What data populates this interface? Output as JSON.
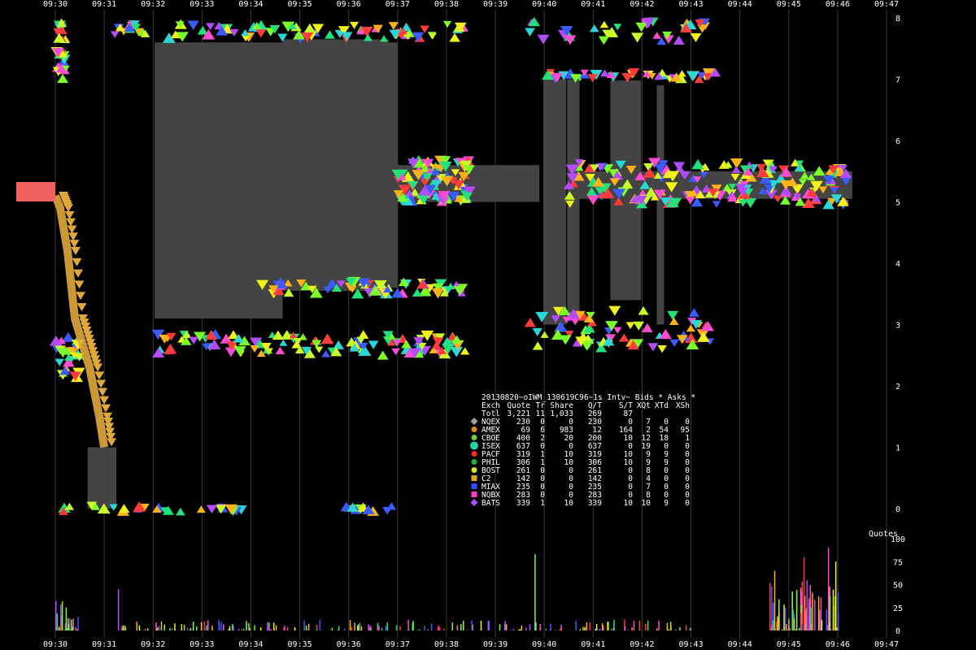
{
  "chart_data": [
    {
      "type": "scatter",
      "title": "20130820~oIWM_130619C96~1s Intv~ Bids * Asks *",
      "x_ticks": [
        "09:30",
        "09:31",
        "09:32",
        "09:33",
        "09:34",
        "09:35",
        "09:36",
        "09:37",
        "09:38",
        "09:39",
        "09:40",
        "09:41",
        "09:42",
        "09:43",
        "09:44",
        "09:45",
        "09:46",
        "09:47"
      ],
      "y_ticks": [
        0,
        1,
        2,
        3,
        4,
        5,
        6,
        7,
        8
      ],
      "ylim": [
        0,
        8
      ],
      "grid": true,
      "colors": {
        "background": "#000000",
        "grid": "#3a3a3a",
        "spread_fill": "#444444",
        "nbbo_walk": "#e0a83a",
        "marker_palette": [
          "#ff3b3b",
          "#ffb21a",
          "#f2f21a",
          "#7bff2a",
          "#22e07a",
          "#2ad6d6",
          "#3a5bff",
          "#b44bff",
          "#ff4bd2",
          "#c8ff2a"
        ]
      },
      "spread_blocks_minutes": [
        {
          "x0": 2.03,
          "x1": 4.65,
          "y0": 3.1,
          "y1": 7.6
        },
        {
          "x0": 4.65,
          "x1": 6.82,
          "y0": 3.55,
          "y1": 7.65
        },
        {
          "x0": 6.82,
          "x1": 7.0,
          "y0": 3.6,
          "y1": 7.6
        },
        {
          "x0": 9.98,
          "x1": 10.45,
          "y0": 3.0,
          "y1": 7.0
        },
        {
          "x0": 10.47,
          "x1": 10.72,
          "y0": 3.1,
          "y1": 7.0
        },
        {
          "x0": 11.35,
          "x1": 11.98,
          "y0": 3.4,
          "y1": 6.98
        },
        {
          "x0": 12.3,
          "x1": 12.45,
          "y0": 3.0,
          "y1": 6.9
        },
        {
          "x0": 0.66,
          "x1": 1.25,
          "y0": 0.0,
          "y1": 1.0
        }
      ],
      "bid_ask_bands_minutes": [
        {
          "x0": 7.0,
          "x1": 9.9,
          "y0": 5.0,
          "y1": 5.6
        },
        {
          "x0": 10.7,
          "x1": 16.3,
          "y0": 5.05,
          "y1": 5.5
        }
      ],
      "nbbo_walk": [
        [
          0.0,
          5.1
        ],
        [
          0.1,
          4.9
        ],
        [
          0.25,
          4.2
        ],
        [
          0.4,
          3.1
        ],
        [
          0.55,
          2.7
        ],
        [
          0.7,
          2.3
        ],
        [
          0.9,
          1.5
        ],
        [
          1.0,
          1.0
        ]
      ],
      "marker_bands": [
        {
          "x0": 0.0,
          "x1": 0.25,
          "y0": 7.0,
          "y1": 7.95,
          "n": 24
        },
        {
          "x0": 1.15,
          "x1": 1.85,
          "y0": 7.7,
          "y1": 7.9,
          "n": 14
        },
        {
          "x0": 2.3,
          "x1": 8.4,
          "y0": 7.65,
          "y1": 7.9,
          "n": 70
        },
        {
          "x0": 9.7,
          "x1": 13.3,
          "y0": 7.6,
          "y1": 7.95,
          "n": 34
        },
        {
          "x0": 10.0,
          "x1": 13.6,
          "y0": 7.0,
          "y1": 7.12,
          "n": 40
        },
        {
          "x0": 7.0,
          "x1": 8.5,
          "y0": 5.0,
          "y1": 5.7,
          "n": 90
        },
        {
          "x0": 10.5,
          "x1": 16.2,
          "y0": 4.95,
          "y1": 5.65,
          "n": 180
        },
        {
          "x0": 4.2,
          "x1": 8.4,
          "y0": 3.5,
          "y1": 3.7,
          "n": 60
        },
        {
          "x0": 2.0,
          "x1": 8.4,
          "y0": 2.5,
          "y1": 2.85,
          "n": 110
        },
        {
          "x0": 9.7,
          "x1": 13.4,
          "y0": 2.6,
          "y1": 3.25,
          "n": 70
        },
        {
          "x0": 0.0,
          "x1": 0.5,
          "y0": 2.1,
          "y1": 2.8,
          "n": 30
        },
        {
          "x0": 0.0,
          "x1": 3.9,
          "y0": -0.05,
          "y1": 0.05,
          "n": 26
        },
        {
          "x0": 5.9,
          "x1": 6.9,
          "y0": -0.05,
          "y1": 0.05,
          "n": 12
        }
      ],
      "legend_table": {
        "title": "20130820~oIWM_130619C96~1s Intv~ Bids * Asks *",
        "columns": [
          "Exch",
          "Quote",
          "Tr",
          "Share",
          "Q/T",
          "S/T",
          "XQt",
          "XTd",
          "XSh"
        ],
        "rows": [
          {
            "exch": "Totl",
            "vals": [
              "3,221",
              "11",
              "1,033",
              "269",
              "87",
              "",
              "",
              ""
            ],
            "color": "",
            "shape": ""
          },
          {
            "exch": "NQEX",
            "vals": [
              "230",
              "0",
              "0",
              "230",
              "0",
              "7",
              "0",
              "0"
            ],
            "color": "#a0a0a0",
            "shape": "diamond"
          },
          {
            "exch": "AMEX",
            "vals": [
              "69",
              "6",
              "983",
              "12",
              "164",
              "2",
              "54",
              "95"
            ],
            "color": "#e08a2a",
            "shape": "circle"
          },
          {
            "exch": "CBOE",
            "vals": [
              "400",
              "2",
              "20",
              "200",
              "10",
              "12",
              "18",
              "1"
            ],
            "color": "#7ac84a",
            "shape": "star"
          },
          {
            "exch": "ISEX",
            "vals": [
              "637",
              "0",
              "0",
              "637",
              "0",
              "19",
              "0",
              "0"
            ],
            "color": "#22d6a8",
            "shape": "bigcircle"
          },
          {
            "exch": "PACF",
            "vals": [
              "319",
              "1",
              "10",
              "319",
              "10",
              "9",
              "9",
              "0"
            ],
            "color": "#ff2a2a",
            "shape": "circle"
          },
          {
            "exch": "PHIL",
            "vals": [
              "306",
              "1",
              "10",
              "306",
              "10",
              "9",
              "9",
              "0"
            ],
            "color": "#22b04a",
            "shape": "circle"
          },
          {
            "exch": "BOST",
            "vals": [
              "261",
              "0",
              "0",
              "261",
              "0",
              "8",
              "0",
              "0"
            ],
            "color": "#c8f02a",
            "shape": "circle"
          },
          {
            "exch": "C2",
            "vals": [
              "142",
              "0",
              "0",
              "142",
              "0",
              "4",
              "0",
              "0"
            ],
            "color": "#e0a020",
            "shape": "square"
          },
          {
            "exch": "MIAX",
            "vals": [
              "235",
              "0",
              "0",
              "235",
              "0",
              "7",
              "0",
              "0"
            ],
            "color": "#3a4bff",
            "shape": "square"
          },
          {
            "exch": "NQBX",
            "vals": [
              "283",
              "0",
              "0",
              "283",
              "0",
              "8",
              "0",
              "0"
            ],
            "color": "#ff3ac8",
            "shape": "square"
          },
          {
            "exch": "BATS",
            "vals": [
              "339",
              "1",
              "10",
              "339",
              "10",
              "10",
              "9",
              "0"
            ],
            "color": "#b44bff",
            "shape": "diamond"
          }
        ]
      }
    },
    {
      "type": "bar",
      "title": "Quotes",
      "y_ticks": [
        0,
        25,
        50,
        75,
        100
      ],
      "ylim": [
        0,
        100
      ],
      "colors": [
        "#7bff2a",
        "#b44bff",
        "#ff4bd2",
        "#22e07a",
        "#3a5bff",
        "#ffb21a",
        "#f2f21a",
        "#ff3b3b"
      ],
      "bursts": [
        {
          "x0": 0.0,
          "x1": 0.5,
          "max": 32,
          "n": 30
        },
        {
          "x0": 1.3,
          "x1": 13.0,
          "max": 12,
          "n": 260
        },
        {
          "x0": 14.6,
          "x1": 16.0,
          "max": 55,
          "n": 120
        }
      ],
      "spikes": [
        [
          0.0,
          32
        ],
        [
          1.28,
          45
        ],
        [
          9.8,
          83
        ],
        [
          14.7,
          65
        ],
        [
          15.3,
          80
        ],
        [
          15.8,
          90
        ],
        [
          15.95,
          75
        ]
      ]
    }
  ]
}
